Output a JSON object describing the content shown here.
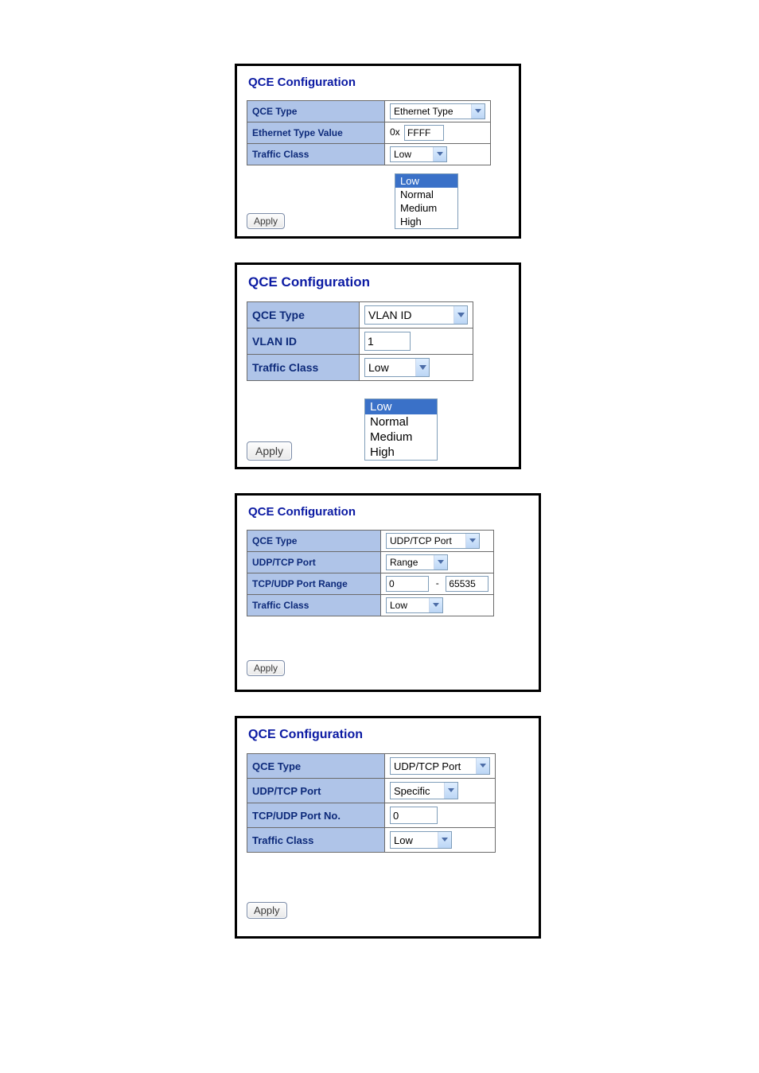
{
  "common": {
    "title": "QCE Configuration",
    "apply_label": "Apply",
    "traffic_options": [
      "Low",
      "Normal",
      "Medium",
      "High"
    ]
  },
  "panel1": {
    "labels": {
      "qce_type": "QCE Type",
      "eth_type_value": "Ethernet Type Value",
      "traffic_class": "Traffic Class"
    },
    "values": {
      "qce_type": "Ethernet Type",
      "eth_prefix": "0x",
      "eth_value": "FFFF",
      "traffic_class": "Low"
    }
  },
  "panel2": {
    "labels": {
      "qce_type": "QCE Type",
      "vlan_id": "VLAN ID",
      "traffic_class": "Traffic Class"
    },
    "values": {
      "qce_type": "VLAN ID",
      "vlan_id": "1",
      "traffic_class": "Low"
    }
  },
  "panel3": {
    "labels": {
      "qce_type": "QCE Type",
      "udp_tcp_port": "UDP/TCP Port",
      "port_range": "TCP/UDP Port Range",
      "traffic_class": "Traffic Class"
    },
    "values": {
      "qce_type": "UDP/TCP Port",
      "udp_tcp_port": "Range",
      "range_low": "0",
      "range_sep": "-",
      "range_high": "65535",
      "traffic_class": "Low"
    }
  },
  "panel4": {
    "labels": {
      "qce_type": "QCE Type",
      "udp_tcp_port": "UDP/TCP Port",
      "port_no": "TCP/UDP Port No.",
      "traffic_class": "Traffic Class"
    },
    "values": {
      "qce_type": "UDP/TCP Port",
      "udp_tcp_port": "Specific",
      "port_no": "0",
      "traffic_class": "Low"
    }
  }
}
